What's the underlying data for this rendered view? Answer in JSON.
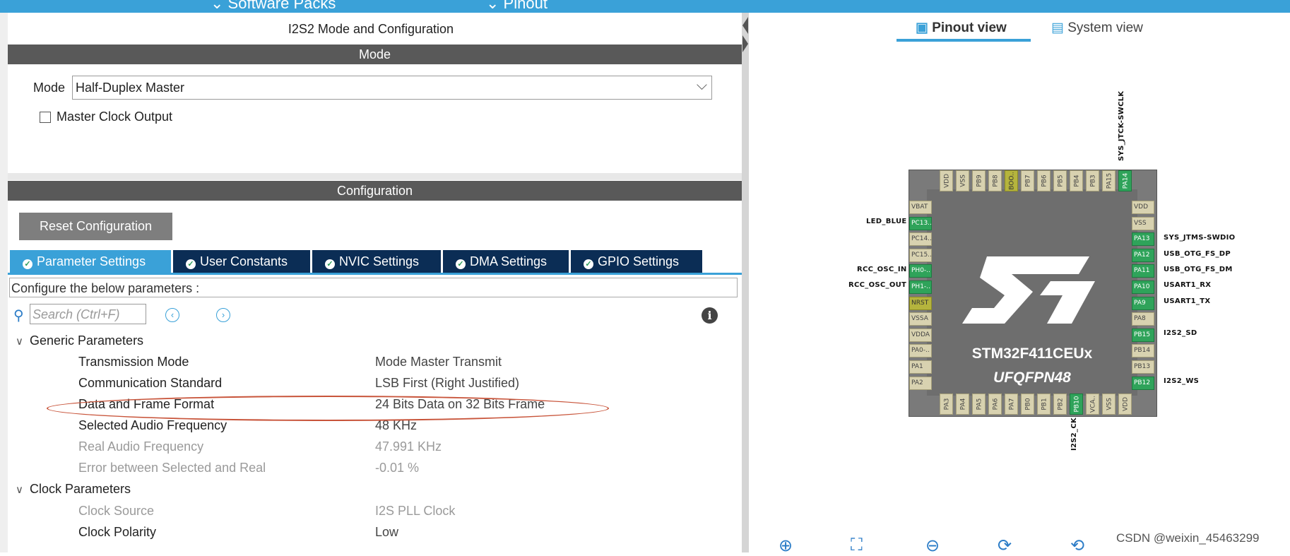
{
  "topbar": {
    "item1": "⌄ Software Packs",
    "item2": "⌄ Pinout"
  },
  "panel": {
    "title": "I2S2 Mode and Configuration",
    "mode_header": "Mode",
    "config_header": "Configuration"
  },
  "mode": {
    "label": "Mode",
    "value": "Half-Duplex Master",
    "master_clock_label": "Master Clock Output"
  },
  "reset_label": "Reset Configuration",
  "tabs": [
    {
      "label": "Parameter Settings"
    },
    {
      "label": "User Constants"
    },
    {
      "label": "NVIC Settings"
    },
    {
      "label": "DMA Settings"
    },
    {
      "label": "GPIO Settings"
    }
  ],
  "configure_text": "Configure the below parameters :",
  "search": {
    "placeholder": "Search (Ctrl+F)"
  },
  "groups": {
    "generic": "Generic Parameters",
    "clock": "Clock Parameters"
  },
  "params": [
    {
      "name": "Transmission Mode",
      "value": "Mode Master Transmit"
    },
    {
      "name": "Communication Standard",
      "value": "LSB First (Right Justified)"
    },
    {
      "name": "Data and Frame Format",
      "value": "24 Bits Data on 32 Bits Frame"
    },
    {
      "name": "Selected Audio Frequency",
      "value": "48 KHz"
    },
    {
      "name": "Real Audio Frequency",
      "value": "47.991 KHz"
    },
    {
      "name": "Error between Selected and Real",
      "value": "-0.01 %"
    }
  ],
  "clock_params": [
    {
      "name": "Clock Source",
      "value": "I2S PLL Clock"
    },
    {
      "name": "Clock Polarity",
      "value": "Low"
    }
  ],
  "views": {
    "pinout": "Pinout view",
    "system": "System view"
  },
  "chip": {
    "name": "STM32F411CEUx",
    "package": "UFQFPN48",
    "top_pins": [
      "VDD",
      "VSS",
      "PB9",
      "PB8",
      "BOO..",
      "PB7",
      "PB6",
      "PB5",
      "PB4",
      "PB3",
      "PA15",
      "PA14"
    ],
    "bottom_pins": [
      "PA3",
      "PA4",
      "PA5",
      "PA6",
      "PA7",
      "PB0",
      "PB1",
      "PB2",
      "PB10",
      "VCA..",
      "VSS",
      "VDD"
    ],
    "left_pins": [
      "VBAT",
      "PC13..",
      "PC14..",
      "PC15..",
      "PH0-..",
      "PH1-..",
      "NRST",
      "VSSA",
      "VDDA",
      "PA0-..",
      "PA1",
      "PA2"
    ],
    "right_pins": [
      "VDD",
      "VSS",
      "PA13",
      "PA12",
      "PA11",
      "PA10",
      "PA9",
      "PA8",
      "PB15",
      "PB14",
      "PB13",
      "PB12"
    ],
    "signals": {
      "top": "SYS_JTCK-SWCLK",
      "bottom": "I2S2_CK",
      "led": "LED_BLUE",
      "osc_in": "RCC_OSC_IN",
      "osc_out": "RCC_OSC_OUT",
      "pa13": "SYS_JTMS-SWDIO",
      "pa12": "USB_OTG_FS_DP",
      "pa11": "USB_OTG_FS_DM",
      "pa10": "USART1_RX",
      "pa9": "USART1_TX",
      "pb15": "I2S2_SD",
      "pb12": "I2S2_WS"
    }
  },
  "watermark": "CSDN @weixin_45463299",
  "colors": {
    "accent": "#3aa1d8",
    "tab_dark": "#0b2d55",
    "pin_green": "#2fa35a",
    "highlight": "#c8543a"
  }
}
